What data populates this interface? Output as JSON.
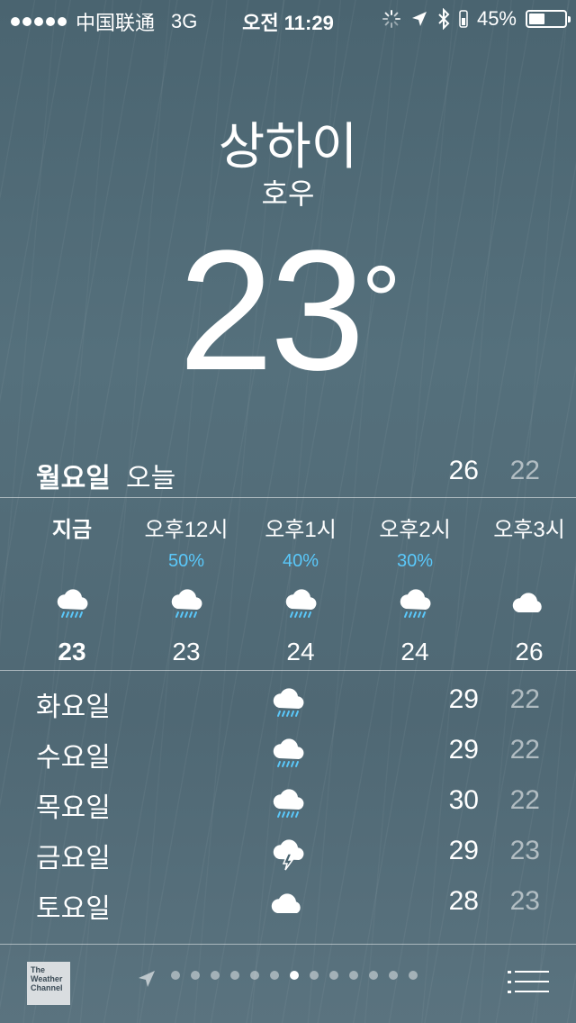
{
  "status_bar": {
    "carrier": "中国联通",
    "network": "3G",
    "time": "오전 11:29",
    "battery_percent": "45%",
    "battery_level": 0.45
  },
  "weather": {
    "city": "상하이",
    "condition": "호우",
    "temperature": "23",
    "degree_symbol": "°"
  },
  "today": {
    "day": "월요일",
    "label": "오늘",
    "high": "26",
    "low": "22"
  },
  "hourly": [
    {
      "time": "지금",
      "precip": "",
      "icon": "rain-cloud-icon",
      "temp": "23",
      "bold": true
    },
    {
      "time": "오후12시",
      "precip": "50%",
      "icon": "rain-cloud-icon",
      "temp": "23"
    },
    {
      "time": "오후1시",
      "precip": "40%",
      "icon": "rain-cloud-icon",
      "temp": "24"
    },
    {
      "time": "오후2시",
      "precip": "30%",
      "icon": "rain-cloud-icon",
      "temp": "24"
    },
    {
      "time": "오후3시",
      "precip": "",
      "icon": "cloud-icon",
      "temp": "26"
    }
  ],
  "daily": [
    {
      "day": "화요일",
      "icon": "rain-cloud-icon",
      "high": "29",
      "low": "22"
    },
    {
      "day": "수요일",
      "icon": "rain-cloud-icon",
      "high": "29",
      "low": "22"
    },
    {
      "day": "목요일",
      "icon": "rain-cloud-icon",
      "high": "30",
      "low": "22"
    },
    {
      "day": "금요일",
      "icon": "thunderstorm-icon",
      "high": "29",
      "low": "23"
    },
    {
      "day": "토요일",
      "icon": "cloud-icon",
      "high": "28",
      "low": "23"
    }
  ],
  "footer": {
    "weather_channel_logo": "The Weather Channel",
    "page_count": 13,
    "active_page": 6
  },
  "colors": {
    "precip_blue": "#5ac8fa",
    "background": "#55707c"
  }
}
